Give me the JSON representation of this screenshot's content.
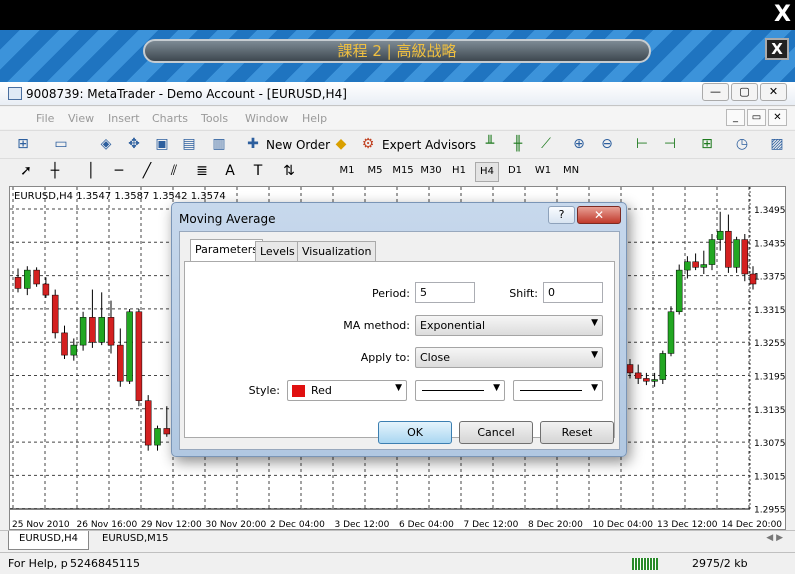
{
  "outer": {
    "close_label": "X"
  },
  "banner": {
    "title": "課程 2 | 高級战略",
    "close_label": "X"
  },
  "window": {
    "title": "9008739: MetaTrader - Demo Account - [EURUSD,H4]",
    "min_label": "—",
    "max_label": "▢",
    "close_label": "✕",
    "mdi": {
      "min": "_",
      "restore": "▭",
      "close": "✕"
    }
  },
  "menu": {
    "items": [
      "File",
      "View",
      "Insert",
      "Charts",
      "Tools",
      "Window",
      "Help"
    ]
  },
  "toolbar": {
    "new_order": "New Order",
    "expert_advisors": "Expert Advisors"
  },
  "timeframes": [
    "M1",
    "M5",
    "M15",
    "M30",
    "H1",
    "H4",
    "D1",
    "W1",
    "MN"
  ],
  "active_timeframe": "H4",
  "chart": {
    "info": "EURUSD,H4  1.3547 1.3587 1.3542 1.3574",
    "price_labels": [
      "1.3495",
      "1.3435",
      "1.3375",
      "1.3315",
      "1.3255",
      "1.3195",
      "1.3135",
      "1.3075",
      "1.3015",
      "1.2955"
    ],
    "time_labels": [
      "25 Nov 2010",
      "26 Nov 16:00",
      "29 Nov 12:00",
      "30 Nov 20:00",
      "2 Dec 04:00",
      "3 Dec 12:00",
      "6 Dec 04:00",
      "7 Dec 12:00",
      "8 Dec 20:00",
      "10 Dec 04:00",
      "13 Dec 12:00",
      "14 Dec 20:00"
    ],
    "bull_color": "#22a722",
    "bear_color": "#d42020"
  },
  "symbol_tabs": [
    "EURUSD,H4",
    "EURUSD,M15"
  ],
  "status": {
    "help": "For Help, p",
    "value": "5246845115",
    "traffic": "2975/2 kb"
  },
  "dialog": {
    "title": "Moving Average",
    "help_label": "?",
    "close_label": "✕",
    "tabs": [
      "Parameters",
      "Levels",
      "Visualization"
    ],
    "period_label": "Period:",
    "period_value": "5",
    "shift_label": "Shift:",
    "shift_value": "0",
    "method_label": "MA method:",
    "method_value": "Exponential",
    "apply_label": "Apply to:",
    "apply_value": "Close",
    "style_label": "Style:",
    "color_value": "Red",
    "color_hex": "#e01010",
    "ok": "OK",
    "cancel": "Cancel",
    "reset": "Reset"
  }
}
